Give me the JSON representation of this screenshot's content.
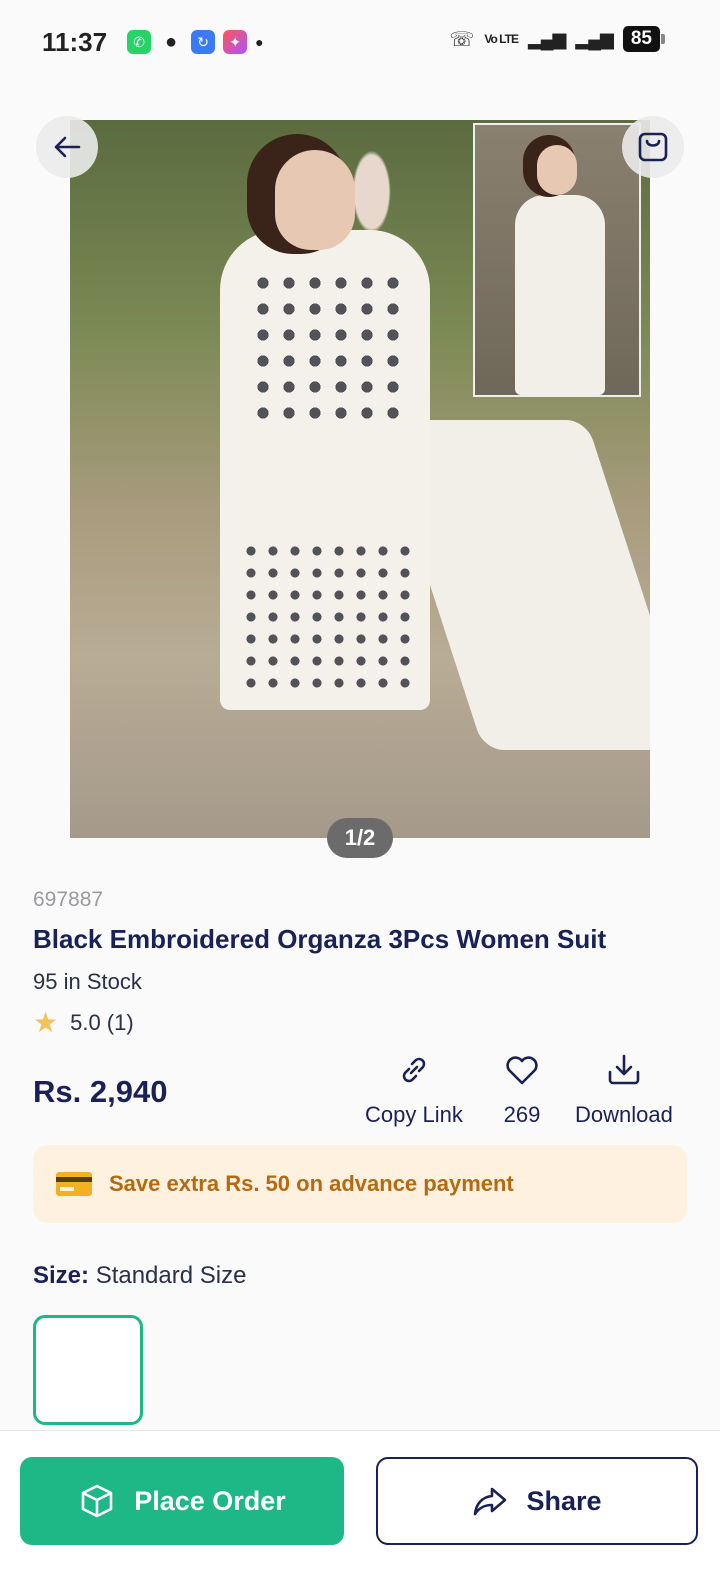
{
  "status_bar": {
    "time": "11:37",
    "battery": "85",
    "network": "Vo LTE"
  },
  "gallery": {
    "pager": "1/2"
  },
  "product": {
    "sku": "697887",
    "title": "Black Embroidered Organza 3Pcs Women Suit",
    "stock": "95 in Stock",
    "rating": "5.0 (1)",
    "price": "Rs. 2,940"
  },
  "actions": {
    "copy_link": "Copy Link",
    "likes": "269",
    "download": "Download"
  },
  "promo": {
    "text": "Save extra Rs. 50 on advance payment"
  },
  "size": {
    "label": "Size:",
    "value": "Standard Size"
  },
  "bottom": {
    "place_order": "Place Order",
    "share": "Share"
  },
  "colors": {
    "accent": "#1db885",
    "navy": "#1a2156",
    "promo_bg": "#fff1df",
    "promo_text": "#b56a11"
  }
}
